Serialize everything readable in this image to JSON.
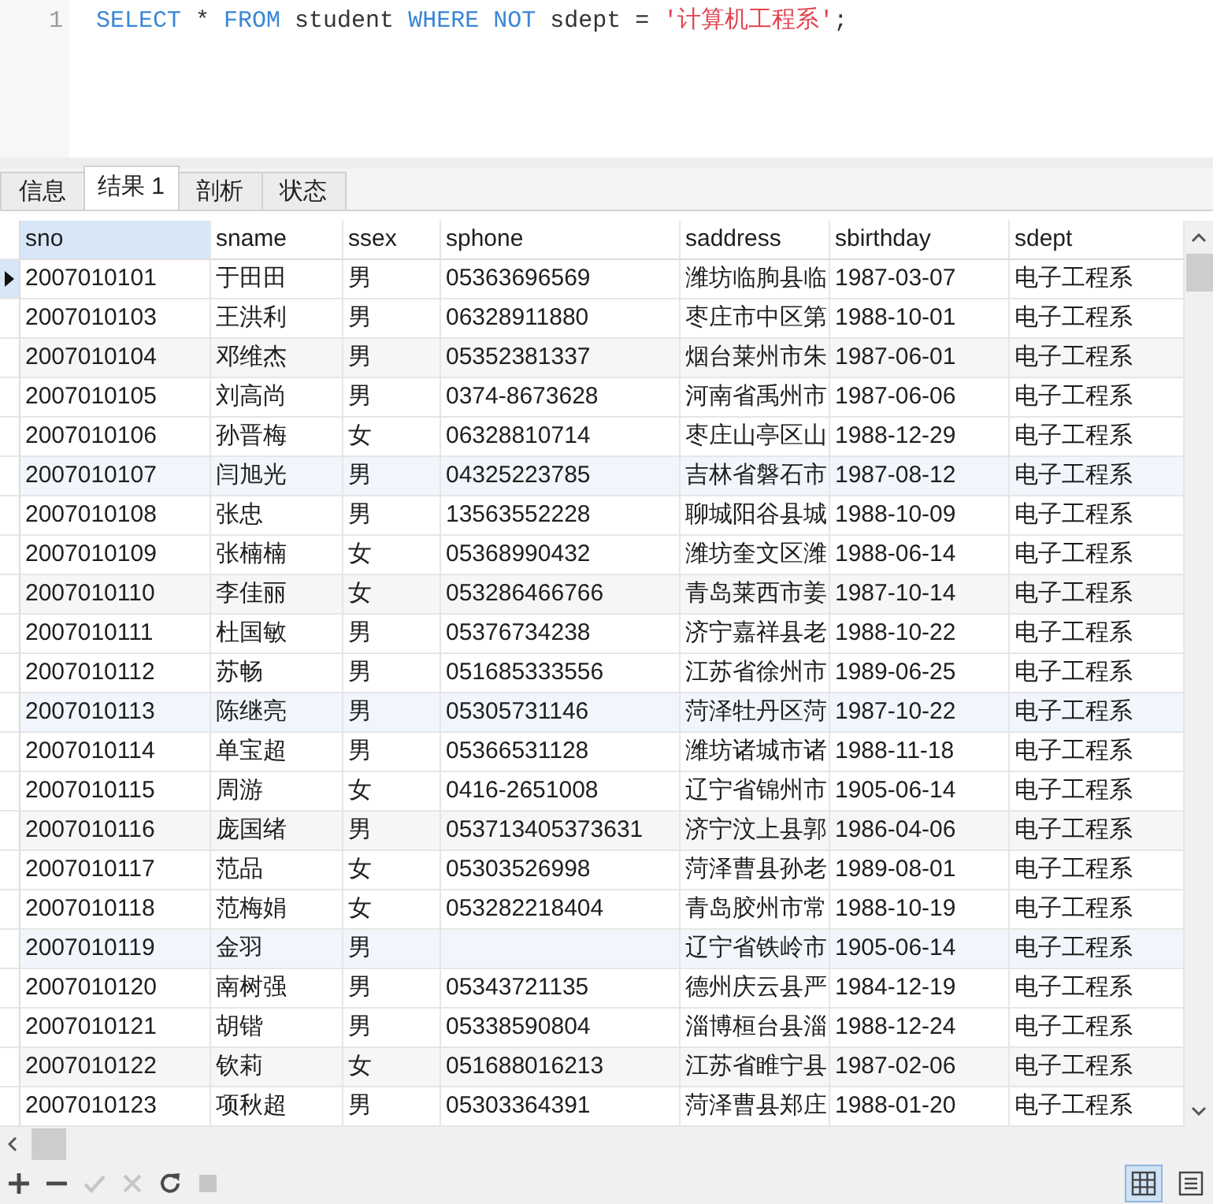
{
  "editor": {
    "line_number": "1",
    "code": [
      {
        "kind": "keyword",
        "text": "SELECT"
      },
      {
        "kind": "plain",
        "text": " * "
      },
      {
        "kind": "keyword",
        "text": "FROM"
      },
      {
        "kind": "plain",
        "text": " student "
      },
      {
        "kind": "keyword",
        "text": "WHERE NOT"
      },
      {
        "kind": "plain",
        "text": " sdept = "
      },
      {
        "kind": "string",
        "text": "'计算机工程系'"
      },
      {
        "kind": "plain",
        "text": ";"
      }
    ]
  },
  "tabs": [
    {
      "label": "信息",
      "selected": false
    },
    {
      "label": "结果 1",
      "selected": true
    },
    {
      "label": "剖析",
      "selected": false
    },
    {
      "label": "状态",
      "selected": false
    }
  ],
  "table": {
    "columns": [
      {
        "label": "sno",
        "selected": true
      },
      {
        "label": "sname",
        "selected": false
      },
      {
        "label": "ssex",
        "selected": false
      },
      {
        "label": "sphone",
        "selected": false
      },
      {
        "label": "saddress",
        "selected": false
      },
      {
        "label": "sbirthday",
        "selected": false
      },
      {
        "label": "sdept",
        "selected": false
      }
    ],
    "rows": [
      {
        "current": true,
        "cells": [
          "2007010101",
          "于田田",
          "男",
          "05363696569",
          "潍坊临朐县临",
          "1987-03-07",
          "电子工程系"
        ]
      },
      {
        "current": false,
        "cells": [
          "2007010103",
          "王洪利",
          "男",
          "06328911880",
          "枣庄市中区第",
          "1988-10-01",
          "电子工程系"
        ]
      },
      {
        "current": false,
        "cells": [
          "2007010104",
          "邓维杰",
          "男",
          "05352381337",
          "烟台莱州市朱",
          "1987-06-01",
          "电子工程系"
        ]
      },
      {
        "current": false,
        "cells": [
          "2007010105",
          "刘高尚",
          "男",
          "0374-8673628",
          "河南省禹州市",
          "1987-06-06",
          "电子工程系"
        ]
      },
      {
        "current": false,
        "cells": [
          "2007010106",
          "孙晋梅",
          "女",
          "06328810714",
          "枣庄山亭区山",
          "1988-12-29",
          "电子工程系"
        ]
      },
      {
        "current": false,
        "cells": [
          "2007010107",
          "闫旭光",
          "男",
          "04325223785",
          "吉林省磐石市",
          "1987-08-12",
          "电子工程系"
        ]
      },
      {
        "current": false,
        "cells": [
          "2007010108",
          "张忠",
          "男",
          "13563552228",
          "聊城阳谷县城",
          "1988-10-09",
          "电子工程系"
        ]
      },
      {
        "current": false,
        "cells": [
          "2007010109",
          "张楠楠",
          "女",
          "05368990432",
          "潍坊奎文区潍",
          "1988-06-14",
          "电子工程系"
        ]
      },
      {
        "current": false,
        "cells": [
          "2007010110",
          "李佳丽",
          "女",
          "053286466766",
          "青岛莱西市姜",
          "1987-10-14",
          "电子工程系"
        ]
      },
      {
        "current": false,
        "cells": [
          "2007010111",
          "杜国敏",
          "男",
          "05376734238",
          "济宁嘉祥县老",
          "1988-10-22",
          "电子工程系"
        ]
      },
      {
        "current": false,
        "cells": [
          "2007010112",
          "苏畅",
          "男",
          "051685333556",
          "江苏省徐州市",
          "1989-06-25",
          "电子工程系"
        ]
      },
      {
        "current": false,
        "cells": [
          "2007010113",
          "陈继亮",
          "男",
          "05305731146",
          "菏泽牡丹区菏",
          "1987-10-22",
          "电子工程系"
        ]
      },
      {
        "current": false,
        "cells": [
          "2007010114",
          "单宝超",
          "男",
          "05366531128",
          "潍坊诸城市诸",
          "1988-11-18",
          "电子工程系"
        ]
      },
      {
        "current": false,
        "cells": [
          "2007010115",
          "周游",
          "女",
          "0416-2651008",
          "辽宁省锦州市",
          "1905-06-14",
          "电子工程系"
        ]
      },
      {
        "current": false,
        "cells": [
          "2007010116",
          "庞国绪",
          "男",
          "053713405373631",
          "济宁汶上县郭",
          "1986-04-06",
          "电子工程系"
        ]
      },
      {
        "current": false,
        "cells": [
          "2007010117",
          "范品",
          "女",
          "05303526998",
          "菏泽曹县孙老",
          "1989-08-01",
          "电子工程系"
        ]
      },
      {
        "current": false,
        "cells": [
          "2007010118",
          "范梅娟",
          "女",
          "053282218404",
          "青岛胶州市常",
          "1988-10-19",
          "电子工程系"
        ]
      },
      {
        "current": false,
        "cells": [
          "2007010119",
          "金羽",
          "男",
          null,
          "辽宁省铁岭市",
          "1905-06-14",
          "电子工程系"
        ]
      },
      {
        "current": false,
        "cells": [
          "2007010120",
          "南树强",
          "男",
          "05343721135",
          "德州庆云县严",
          "1984-12-19",
          "电子工程系"
        ]
      },
      {
        "current": false,
        "cells": [
          "2007010121",
          "胡锴",
          "男",
          "05338590804",
          "淄博桓台县淄",
          "1988-12-24",
          "电子工程系"
        ]
      },
      {
        "current": false,
        "cells": [
          "2007010122",
          "钦莉",
          "女",
          "051688016213",
          "江苏省睢宁县",
          "1987-02-06",
          "电子工程系"
        ]
      },
      {
        "current": false,
        "cells": [
          "2007010123",
          "项秋超",
          "男",
          "05303364391",
          "菏泽曹县郑庄",
          "1988-01-20",
          "电子工程系"
        ]
      }
    ]
  },
  "toolbar": [
    {
      "kind": "add",
      "disabled": false
    },
    {
      "kind": "delete",
      "disabled": false
    },
    {
      "kind": "apply",
      "disabled": true
    },
    {
      "kind": "discard",
      "disabled": true
    },
    {
      "kind": "refresh",
      "disabled": false
    },
    {
      "kind": "stop",
      "disabled": true
    }
  ],
  "view_switch": [
    {
      "kind": "grid",
      "selected": true
    },
    {
      "kind": "form",
      "selected": false
    }
  ]
}
